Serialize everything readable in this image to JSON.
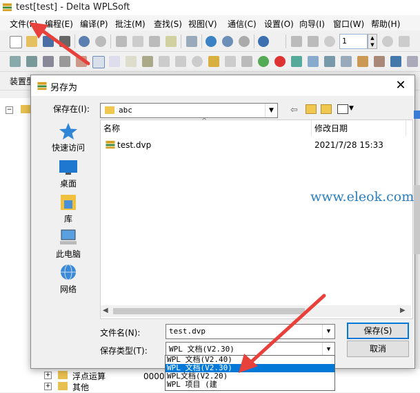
{
  "window": {
    "title": "test[test] - Delta WPLSoft"
  },
  "menu": [
    "文件(F)",
    "编程(E)",
    "编译(P)",
    "批注(M)",
    "查找(S)",
    "视图(V)",
    "通信(C)",
    "设置(O)",
    "向导(I)",
    "窗口(W)",
    "帮助(H)"
  ],
  "toolbar": {
    "step_value": "1"
  },
  "left_label": "装置型",
  "tree_bottom": [
    "浮点运算",
    "其他"
  ],
  "status_partial": "0000",
  "dialog": {
    "title": "另存为",
    "save_in_label": "保存在(I):",
    "save_in_value": "abc",
    "places": [
      "快速访问",
      "桌面",
      "库",
      "此电脑",
      "网络"
    ],
    "columns": {
      "name": "名称",
      "modified": "修改日期"
    },
    "files": [
      {
        "name": "test.dvp",
        "modified": "2021/7/28 15:33"
      }
    ],
    "filename_label": "文件名(N):",
    "filename_value": "test.dvp",
    "filetype_label": "保存类型(T):",
    "filetype_value": "WPL 文档(V2.30)",
    "save_button": "保存(S)",
    "cancel_button": "取消",
    "filetype_options": [
      "WPL 文档(V2.40)",
      "WPL 文档(V2.30)",
      "WPL文档(V2.20)",
      "WPL 项目 (建"
    ],
    "selected_option_index": 1
  },
  "watermark": "www.eleok.com",
  "colors": {
    "selection": "#0078d7",
    "annotation_arrow": "#e8403a"
  }
}
